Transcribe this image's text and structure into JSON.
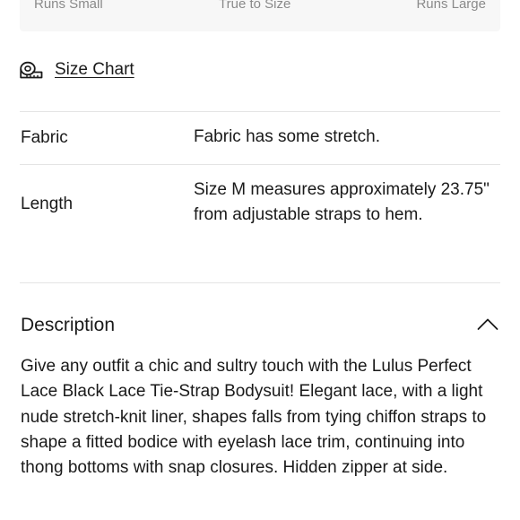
{
  "fit_scale": {
    "runs_small": "Runs Small",
    "true_to_size": "True to Size",
    "runs_large": "Runs Large"
  },
  "size_chart": {
    "label": "Size Chart",
    "icon": "measuring-tape-icon"
  },
  "specs": [
    {
      "key": "Fabric",
      "value": "Fabric has some stretch."
    },
    {
      "key": "Length",
      "value": "Size M measures approximately 23.75\" from adjustable straps to hem."
    }
  ],
  "description": {
    "title": "Description",
    "toggle_icon": "chevron-up-icon",
    "expanded": true,
    "text": "Give any outfit a chic and sultry touch with the Lulus Perfect Lace Black Lace Tie-Strap Bodysuit! Elegant lace, with a light nude stretch-knit liner, shapes falls from tying chiffon straps to shape a fitted bodice with eyelash lace trim, continuing into thong bottoms with snap closures. Hidden zipper at side."
  },
  "colors": {
    "text": "#1a1a1a",
    "muted": "#8a8a8a",
    "divider": "#e4e4e4",
    "fit_bar_bg": "#f7f7f7"
  }
}
